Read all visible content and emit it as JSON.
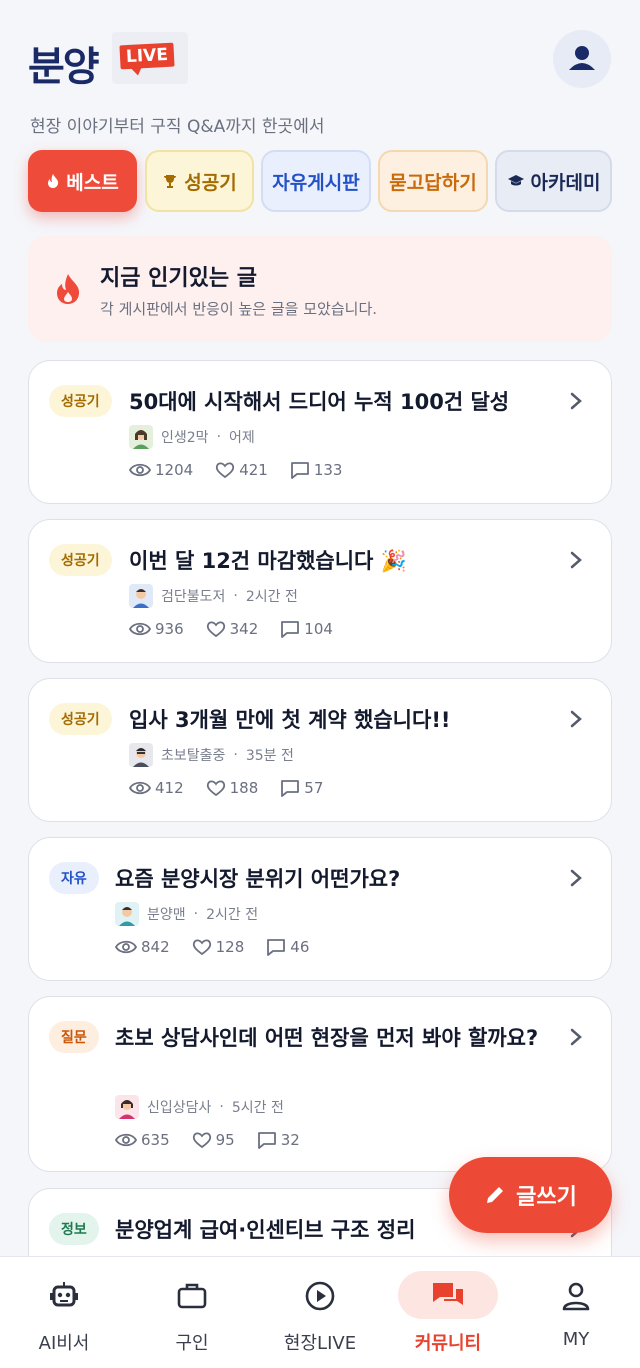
{
  "header": {
    "logo_text": "분양",
    "live_badge": "LIVE",
    "tagline": "현장 이야기부터 구직 Q&A까지 한곳에서",
    "profile_icon": "person-icon"
  },
  "tabs": [
    {
      "label": "베스트",
      "icon": "flame-icon"
    },
    {
      "label": "성공기",
      "icon": "trophy-icon"
    },
    {
      "label": "자유게시판"
    },
    {
      "label": "묻고답하기"
    },
    {
      "label": "아카데미",
      "icon": "graduation-cap-icon"
    }
  ],
  "hot": {
    "title": "지금 인기있는 글",
    "subtitle": "각 게시판에서 반응이 높은 글을 모았습니다."
  },
  "posts": [
    {
      "category": "성공기",
      "title": "50대에 시작해서 드디어 누적 100건 달성",
      "author": "인생2막",
      "time": "어제",
      "views": "1204",
      "likes": "421",
      "comments": "133"
    },
    {
      "category": "성공기",
      "title": "이번 달 12건 마감했습니다 🎉",
      "author": "검단불도저",
      "time": "2시간 전",
      "views": "936",
      "likes": "342",
      "comments": "104"
    },
    {
      "category": "성공기",
      "title": "입사 3개월 만에 첫 계약 했습니다!!",
      "author": "초보탈출중",
      "time": "35분 전",
      "views": "412",
      "likes": "188",
      "comments": "57"
    },
    {
      "category": "자유",
      "title": "요즘 분양시장 분위기 어떤가요?",
      "author": "분양맨",
      "time": "2시간 전",
      "views": "842",
      "likes": "128",
      "comments": "46"
    },
    {
      "category": "질문",
      "title": "초보 상담사인데 어떤 현장을 먼저 봐야 할까요?",
      "author": "신입상담사",
      "time": "5시간 전",
      "views": "635",
      "likes": "95",
      "comments": "32"
    },
    {
      "category": "정보",
      "title": "분양업계 급여·인센티브 구조 정리"
    }
  ],
  "fab": {
    "label": "글쓰기",
    "icon": "pencil-icon"
  },
  "bottom_nav": [
    {
      "label": "AI비서",
      "icon": "robot-icon"
    },
    {
      "label": "구인",
      "icon": "briefcase-icon"
    },
    {
      "label": "현장LIVE",
      "icon": "play-circle-icon"
    },
    {
      "label": "커뮤니티",
      "icon": "chat-bubbles-icon",
      "active": true
    },
    {
      "label": "MY",
      "icon": "person-icon"
    }
  ],
  "colors": {
    "accent": "#e8412e",
    "logo": "#1a2a66",
    "success": "#a36b00",
    "free": "#2352c7",
    "qa": "#c96a0b",
    "info": "#1f7a4f"
  }
}
